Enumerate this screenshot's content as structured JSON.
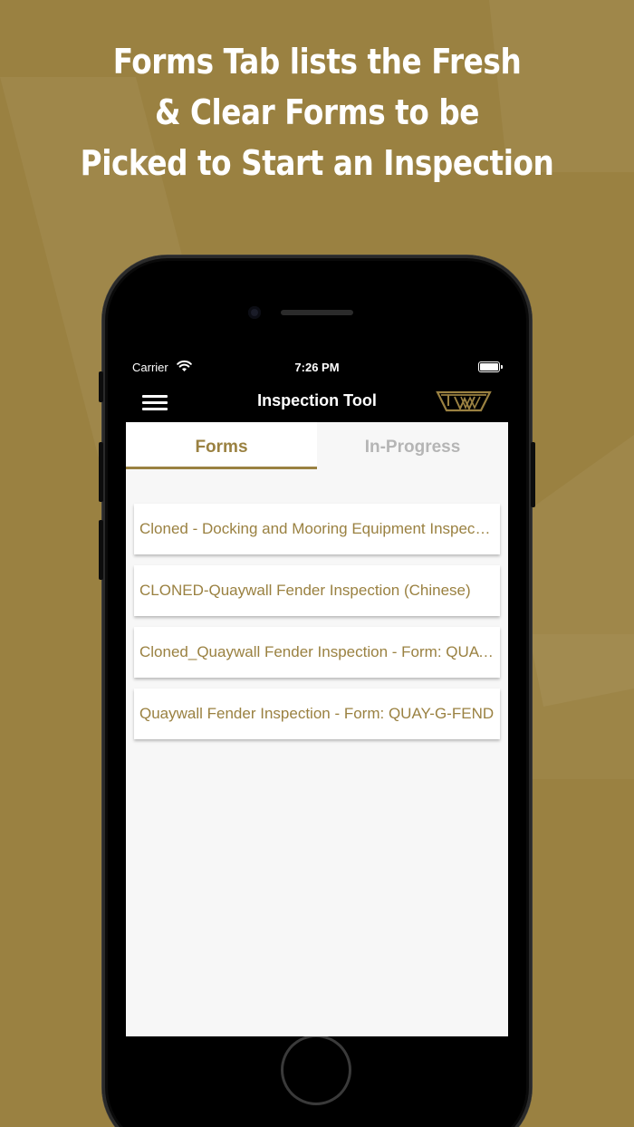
{
  "headline": {
    "line1": "Forms Tab lists the Fresh",
    "line2": "& Clear Forms to be",
    "line3": "Picked to Start an Inspection"
  },
  "status_bar": {
    "carrier": "Carrier",
    "time": "7:26 PM",
    "icons": [
      "wifi-icon",
      "battery-icon"
    ]
  },
  "nav": {
    "title": "Inspection Tool",
    "left_icon": "menu-icon",
    "right_icon": "brand-logo"
  },
  "tabs": [
    {
      "label": "Forms",
      "selected": true
    },
    {
      "label": "In-Progress",
      "selected": false
    }
  ],
  "forms": [
    "Cloned - Docking and Mooring Equipment Inspection",
    "CLONED-Quaywall Fender Inspection (Chinese)",
    "Cloned_Quaywall Fender Inspection - Form: QUAY-G-FEND",
    "Quaywall Fender Inspection - Form: QUAY-G-FEND"
  ],
  "colors": {
    "brand_gold": "#9a8141",
    "inactive_tab": "#b5b5b5",
    "bar_black": "#000000"
  }
}
